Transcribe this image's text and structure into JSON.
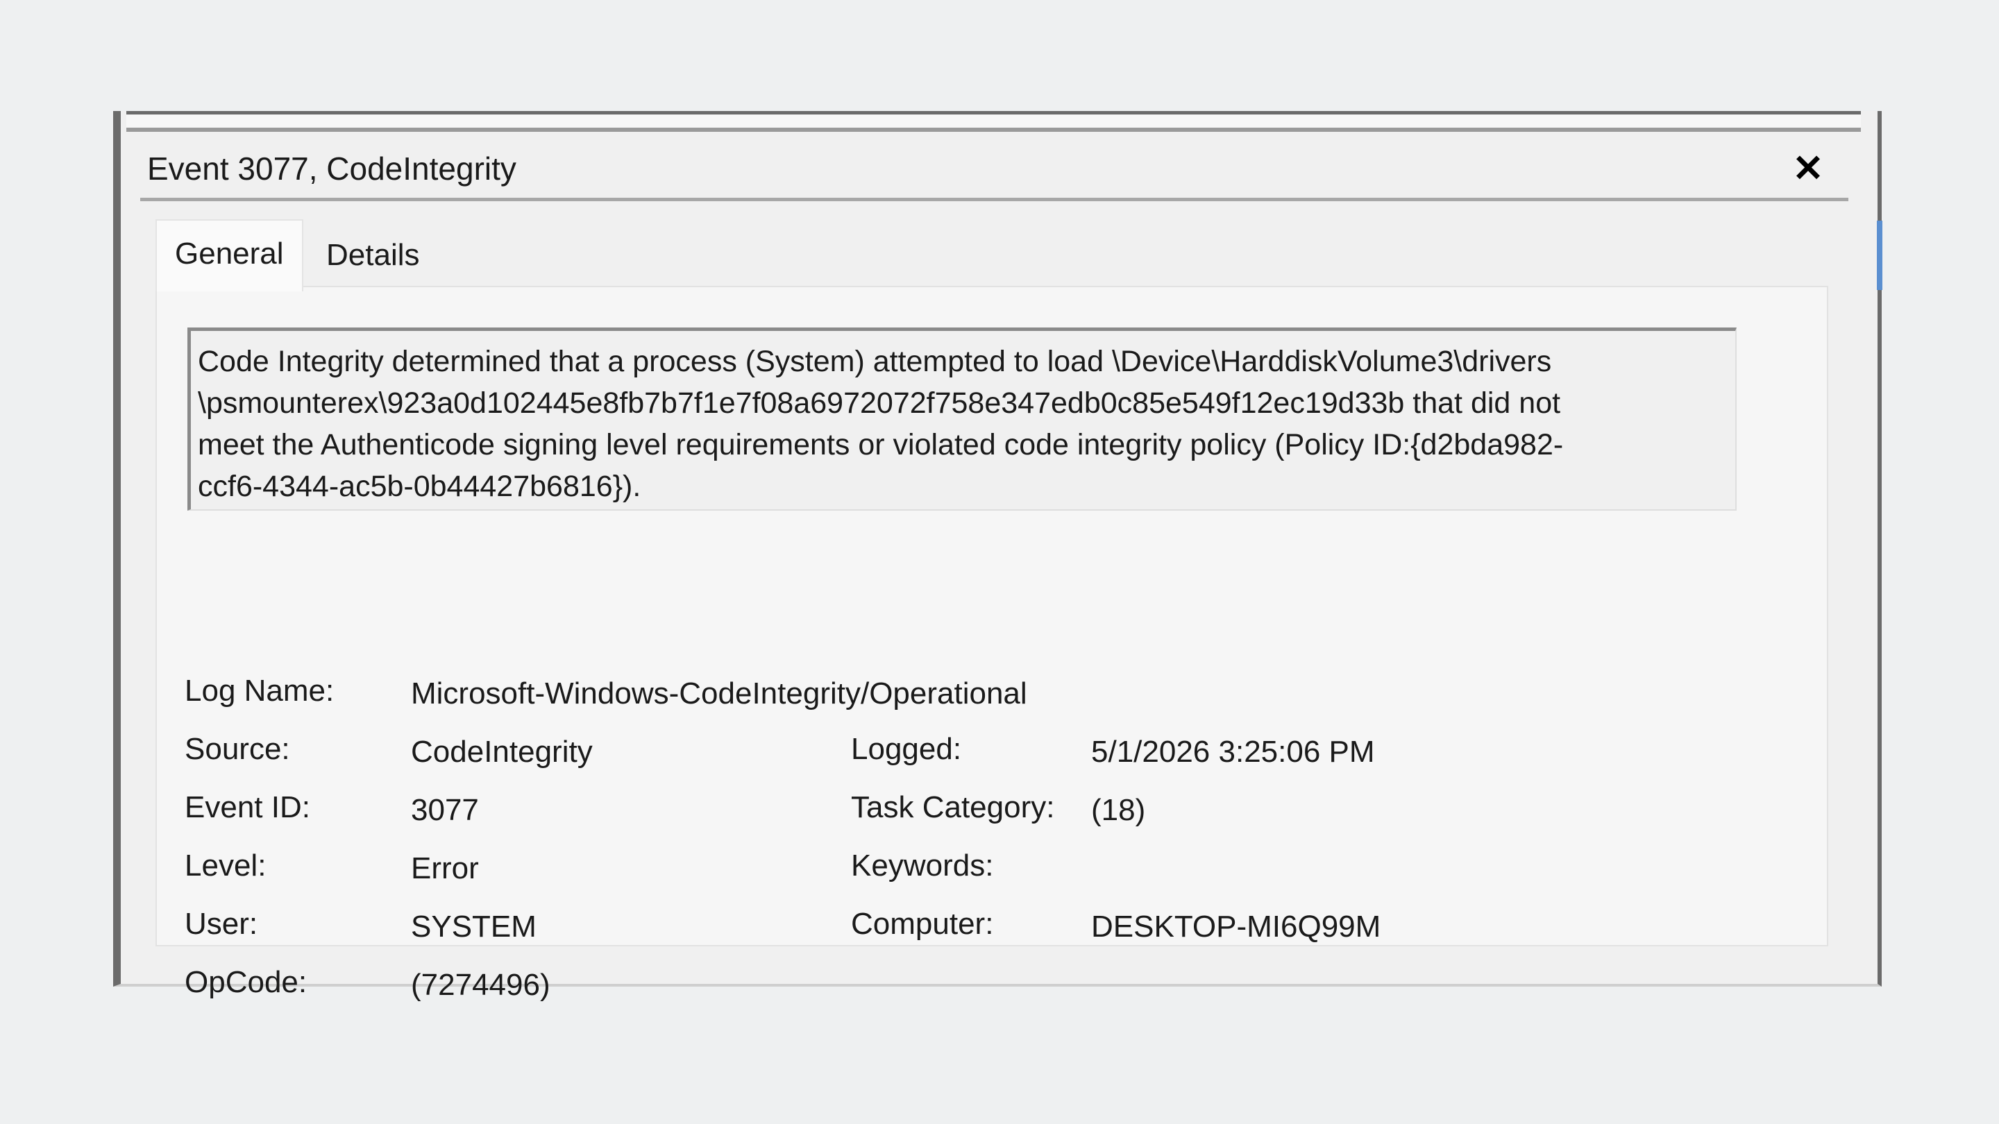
{
  "window": {
    "title": "Event 3077, CodeIntegrity",
    "close_glyph": "✕"
  },
  "tabs": [
    {
      "label": "General",
      "active": true
    },
    {
      "label": "Details",
      "active": false
    }
  ],
  "message": {
    "lines": [
      "Code Integrity determined that a process (System) attempted to load \\Device\\HarddiskVolume3\\drivers",
      "\\psmounterex\\923a0d102445e8fb7b7f1e7f08a6972072f758e347edb0c85e549f12ec19d33b that did not",
      "meet the Authenticode signing level requirements or violated code integrity policy (Policy ID:{d2bda982-",
      "ccf6-4344-ac5b-0b44427b6816})."
    ]
  },
  "fields": {
    "log_name": {
      "label": "Log Name:",
      "value": "Microsoft-Windows-CodeIntegrity/Operational"
    },
    "source": {
      "label": "Source:",
      "value": "CodeIntegrity"
    },
    "logged": {
      "label": "Logged:",
      "value": "5/1/2026 3:25:06 PM"
    },
    "event_id": {
      "label": "Event ID:",
      "value": "3077"
    },
    "task_category": {
      "label": "Task Category:",
      "value": "(18)"
    },
    "level": {
      "label": "Level:",
      "value": "Error"
    },
    "keywords": {
      "label": "Keywords:",
      "value": ""
    },
    "user": {
      "label": "User:",
      "value": "SYSTEM"
    },
    "computer": {
      "label": "Computer:",
      "value": "DESKTOP-MI6Q99M"
    },
    "opcode": {
      "label": "OpCode:",
      "value": "(7274496)"
    }
  },
  "colors": {
    "page_background": "#eef0f1",
    "dialog_background": "#f0f0f0",
    "scroll_accent": "#5b8fd0"
  }
}
